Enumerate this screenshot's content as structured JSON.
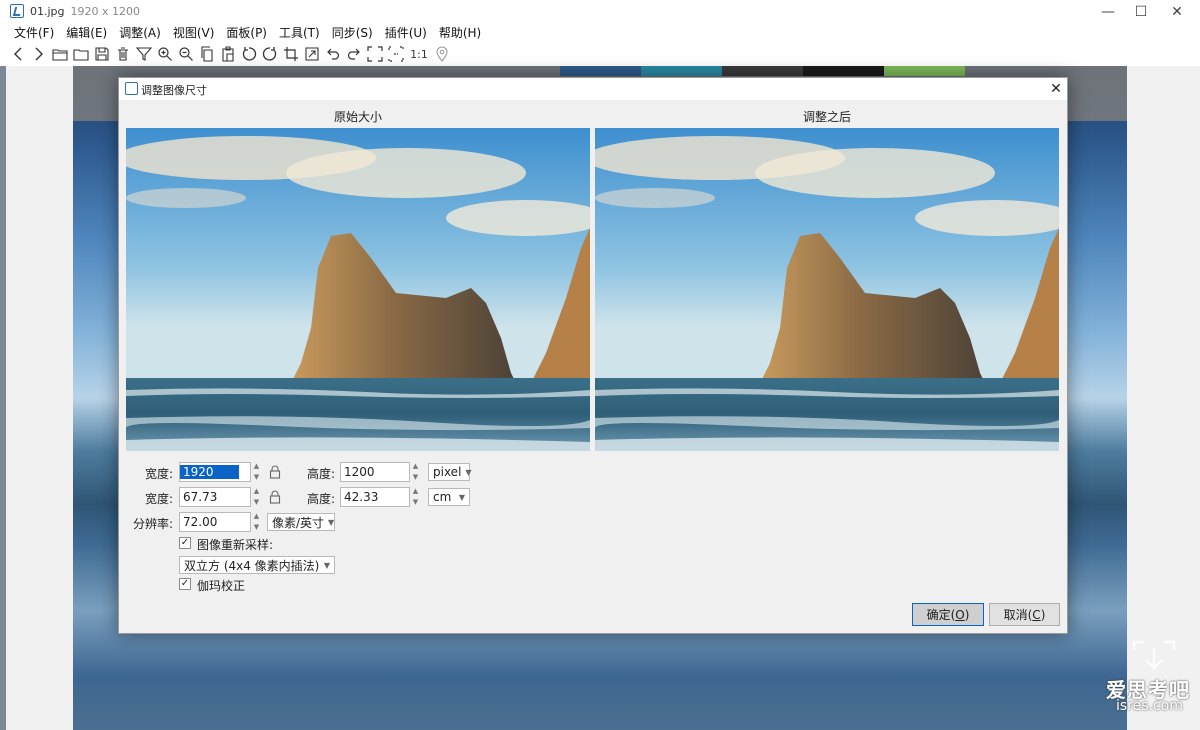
{
  "window": {
    "file_name": "01.jpg",
    "dimensions": "1920 x 1200",
    "buttons": {
      "minimize": "—",
      "maximize": "☐",
      "close": "✕"
    }
  },
  "menu": [
    "文件(F)",
    "编辑(E)",
    "调整(A)",
    "视图(V)",
    "面板(P)",
    "工具(T)",
    "同步(S)",
    "插件(U)",
    "帮助(H)"
  ],
  "toolbar": [
    "back-icon",
    "forward-icon",
    "open-folder-icon",
    "folder-icon",
    "save-icon",
    "delete-icon",
    "filter-icon",
    "zoom-in-icon",
    "zoom-out-icon",
    "copy-icon",
    "paste-icon",
    "rotate-left-icon",
    "rotate-right-icon",
    "crop-icon",
    "resize-icon",
    "undo-icon",
    "redo-icon",
    "fit-icon",
    "fit-width-icon",
    "actual-size-icon",
    "location-icon"
  ],
  "toolbar_actual_size": "1:1",
  "dialog": {
    "title": "调整图像尺寸",
    "close_label": "✕",
    "preview_left_caption": "原始大小",
    "preview_right_caption": "调整之后",
    "pixel_row": {
      "width_label": "宽度:",
      "width_value": "1920",
      "height_label": "高度:",
      "height_value": "1200",
      "unit": "pixel"
    },
    "cm_row": {
      "width_label": "宽度:",
      "width_value": "67.73",
      "height_label": "高度:",
      "height_value": "42.33",
      "unit": "cm"
    },
    "resolution": {
      "label": "分辨率:",
      "value": "72.00",
      "unit": "像素/英寸"
    },
    "resample": {
      "label": "图像重新采样:",
      "checked": true,
      "method": "双立方 (4x4 像素内插法)"
    },
    "gamma": {
      "label": "伽玛校正",
      "checked": true
    },
    "ok_label": "确定(",
    "ok_key": "O",
    "ok_tail": ")",
    "cancel_label": "取消(",
    "cancel_key": "C",
    "cancel_tail": ")"
  },
  "watermark": {
    "text": "爱思考吧",
    "sub": "isres.com"
  },
  "colors": {
    "accent": "#0a64c8",
    "dialog_bg": "#f0f0f0",
    "icon_blue": "#2d6fb6"
  }
}
